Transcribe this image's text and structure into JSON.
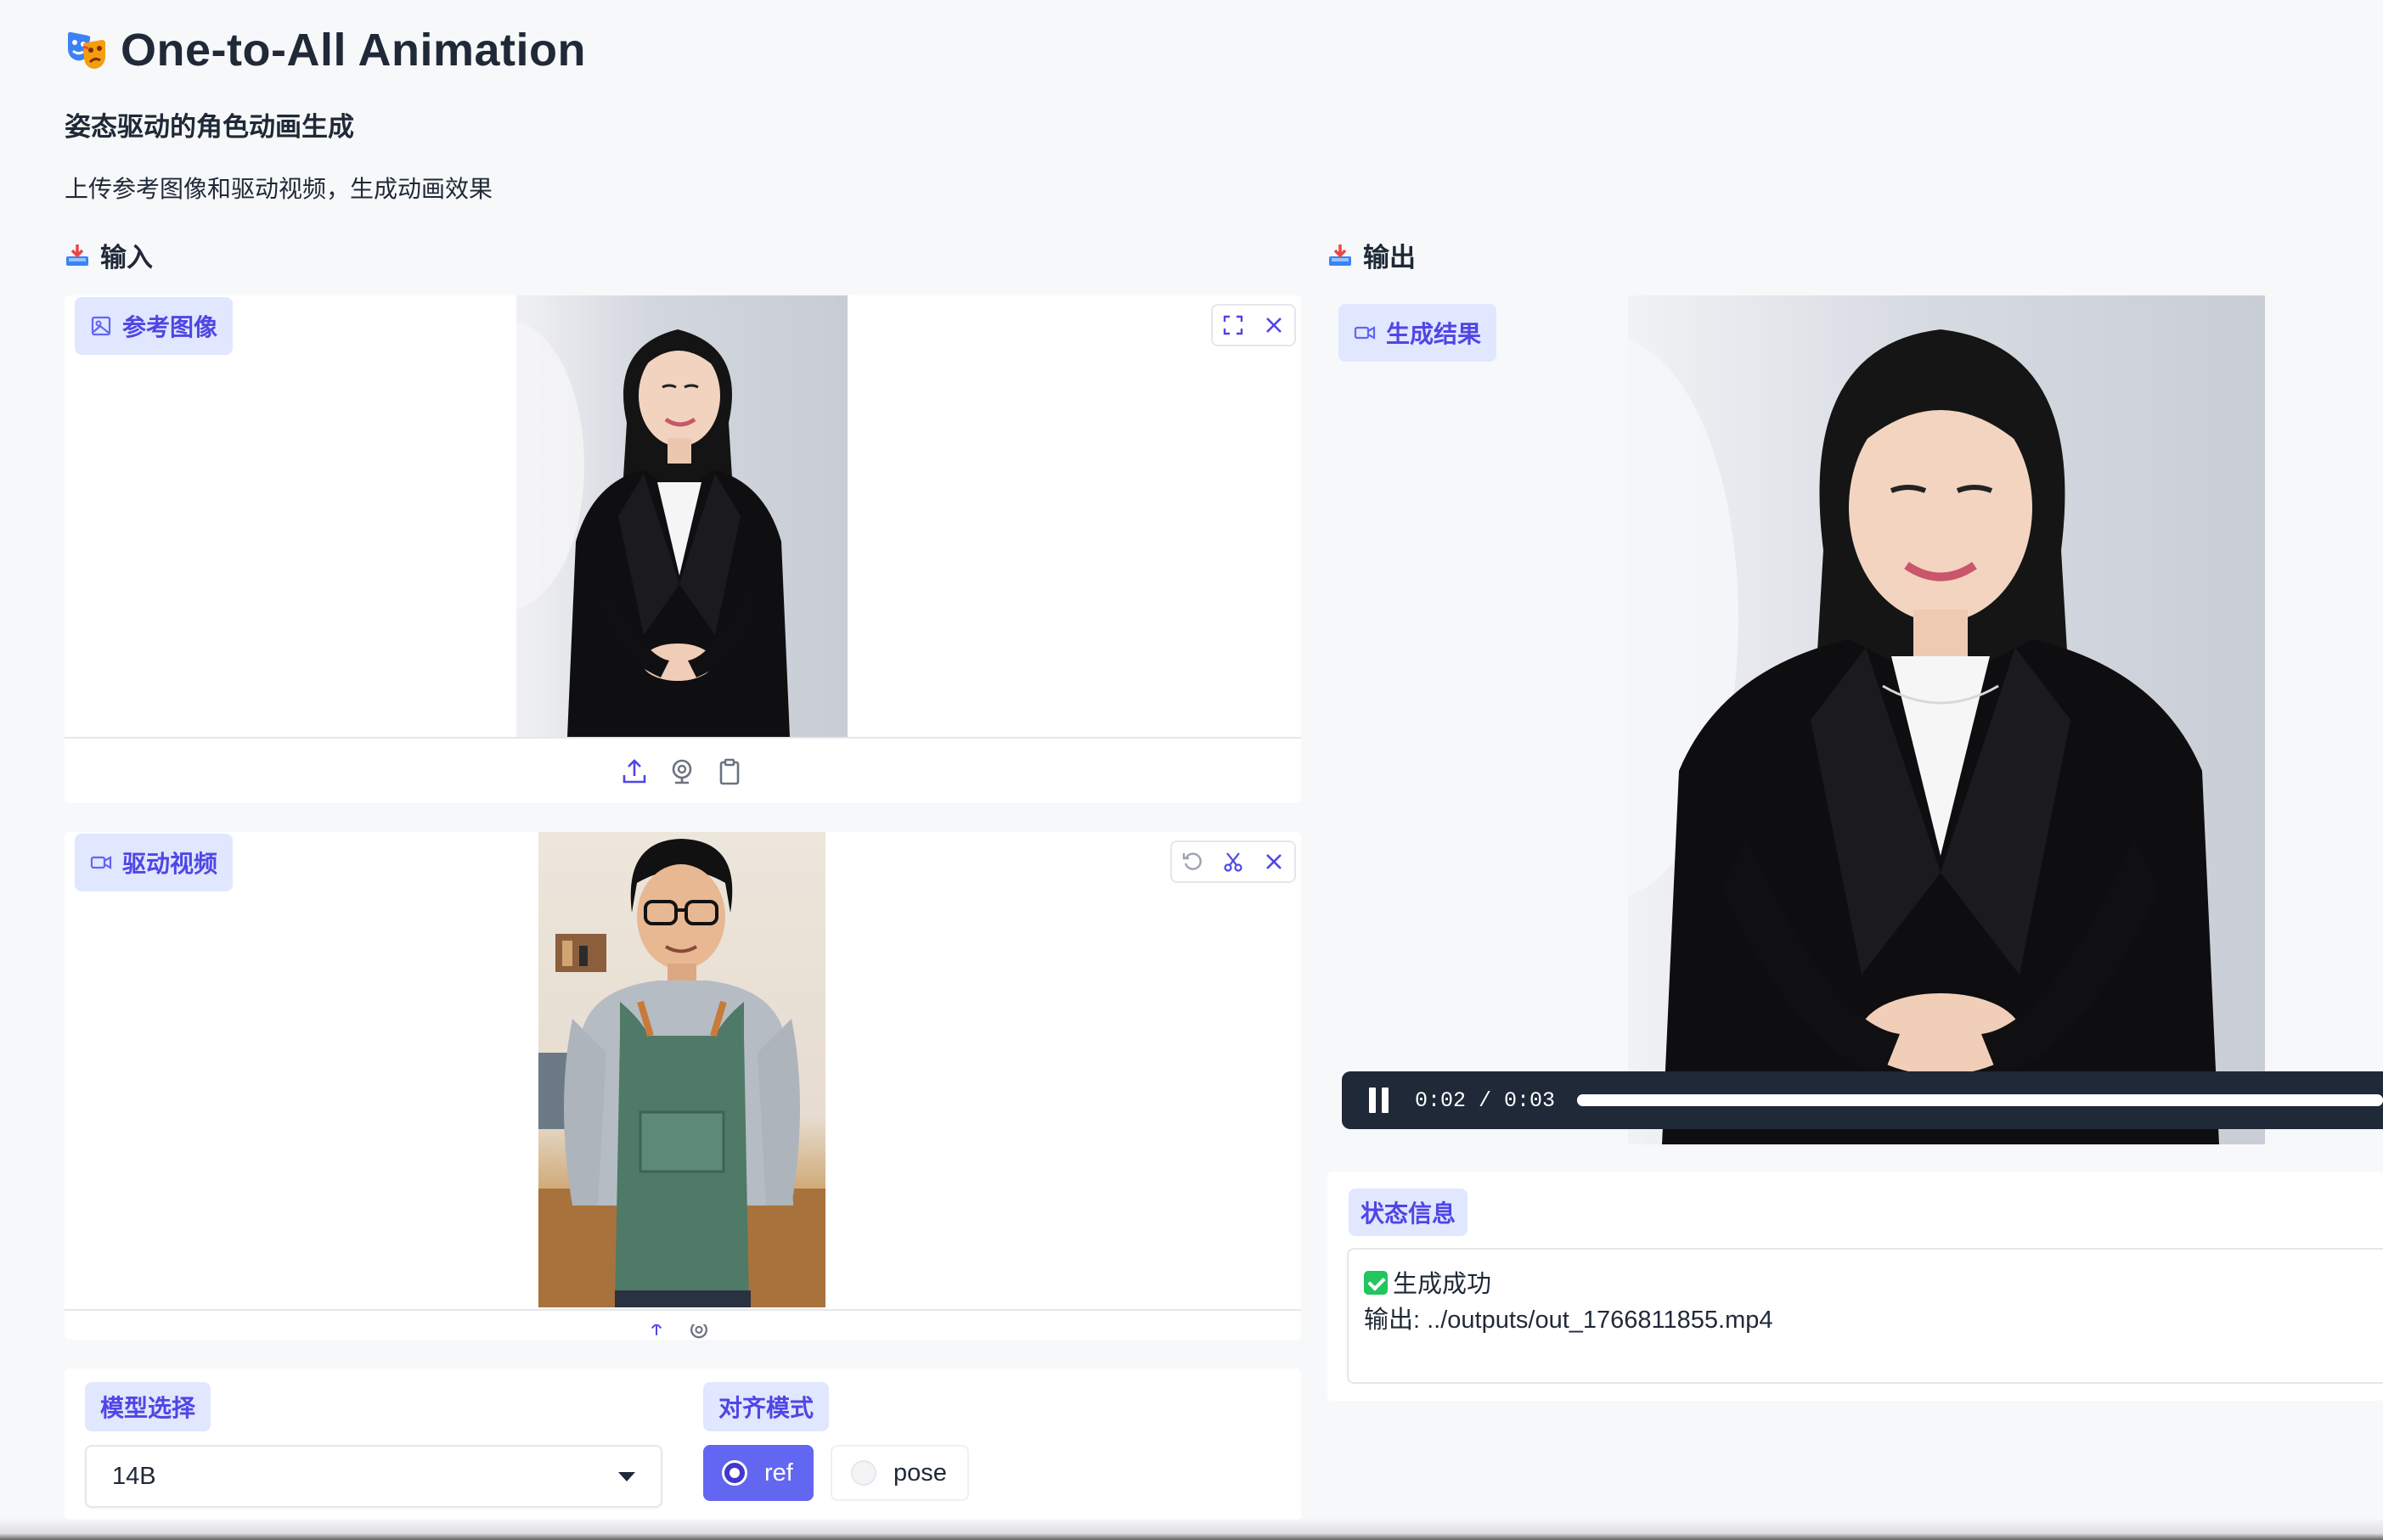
{
  "header": {
    "title": "One-to-All Animation",
    "title_icon": "performing-arts-masks-emoji",
    "subtitle": "姿态驱动的角色动画生成",
    "description": "上传参考图像和驱动视频，生成动画效果"
  },
  "input_section": {
    "heading": "输入",
    "heading_icon": "inbox-tray-emoji",
    "reference_image": {
      "label": "参考图像",
      "label_icon": "image-icon",
      "toolbar_icons": [
        "fullscreen-icon",
        "close-icon"
      ],
      "source_icons": [
        "upload-icon",
        "webcam-icon",
        "clipboard-icon"
      ]
    },
    "driving_video": {
      "label": "驱动视频",
      "label_icon": "video-camera-icon",
      "toolbar_icons": [
        "undo-icon",
        "scissors-icon",
        "close-icon"
      ],
      "source_icons": [
        "upload-icon",
        "webcam-icon"
      ]
    },
    "model_select": {
      "label": "模型选择",
      "value": "14B"
    },
    "align_mode": {
      "label": "对齐模式",
      "options": [
        "ref",
        "pose"
      ],
      "selected": "ref"
    }
  },
  "output_section": {
    "heading": "输出",
    "heading_icon": "inbox-tray-emoji",
    "result": {
      "label": "生成结果",
      "label_icon": "video-camera-icon",
      "current_time": "0:02",
      "duration": "0:03",
      "time_display": "0:02 / 0:03",
      "progress": 1.0
    },
    "status": {
      "label": "状态信息",
      "line1": "生成成功",
      "line2": "输出: ../outputs/out_1766811855.mp4"
    }
  },
  "colors": {
    "accent": "#6366f1",
    "chip_bg": "#e0e7ff",
    "chip_text": "#4f46e5",
    "video_bar": "#1f2937",
    "success": "#22c55e"
  }
}
